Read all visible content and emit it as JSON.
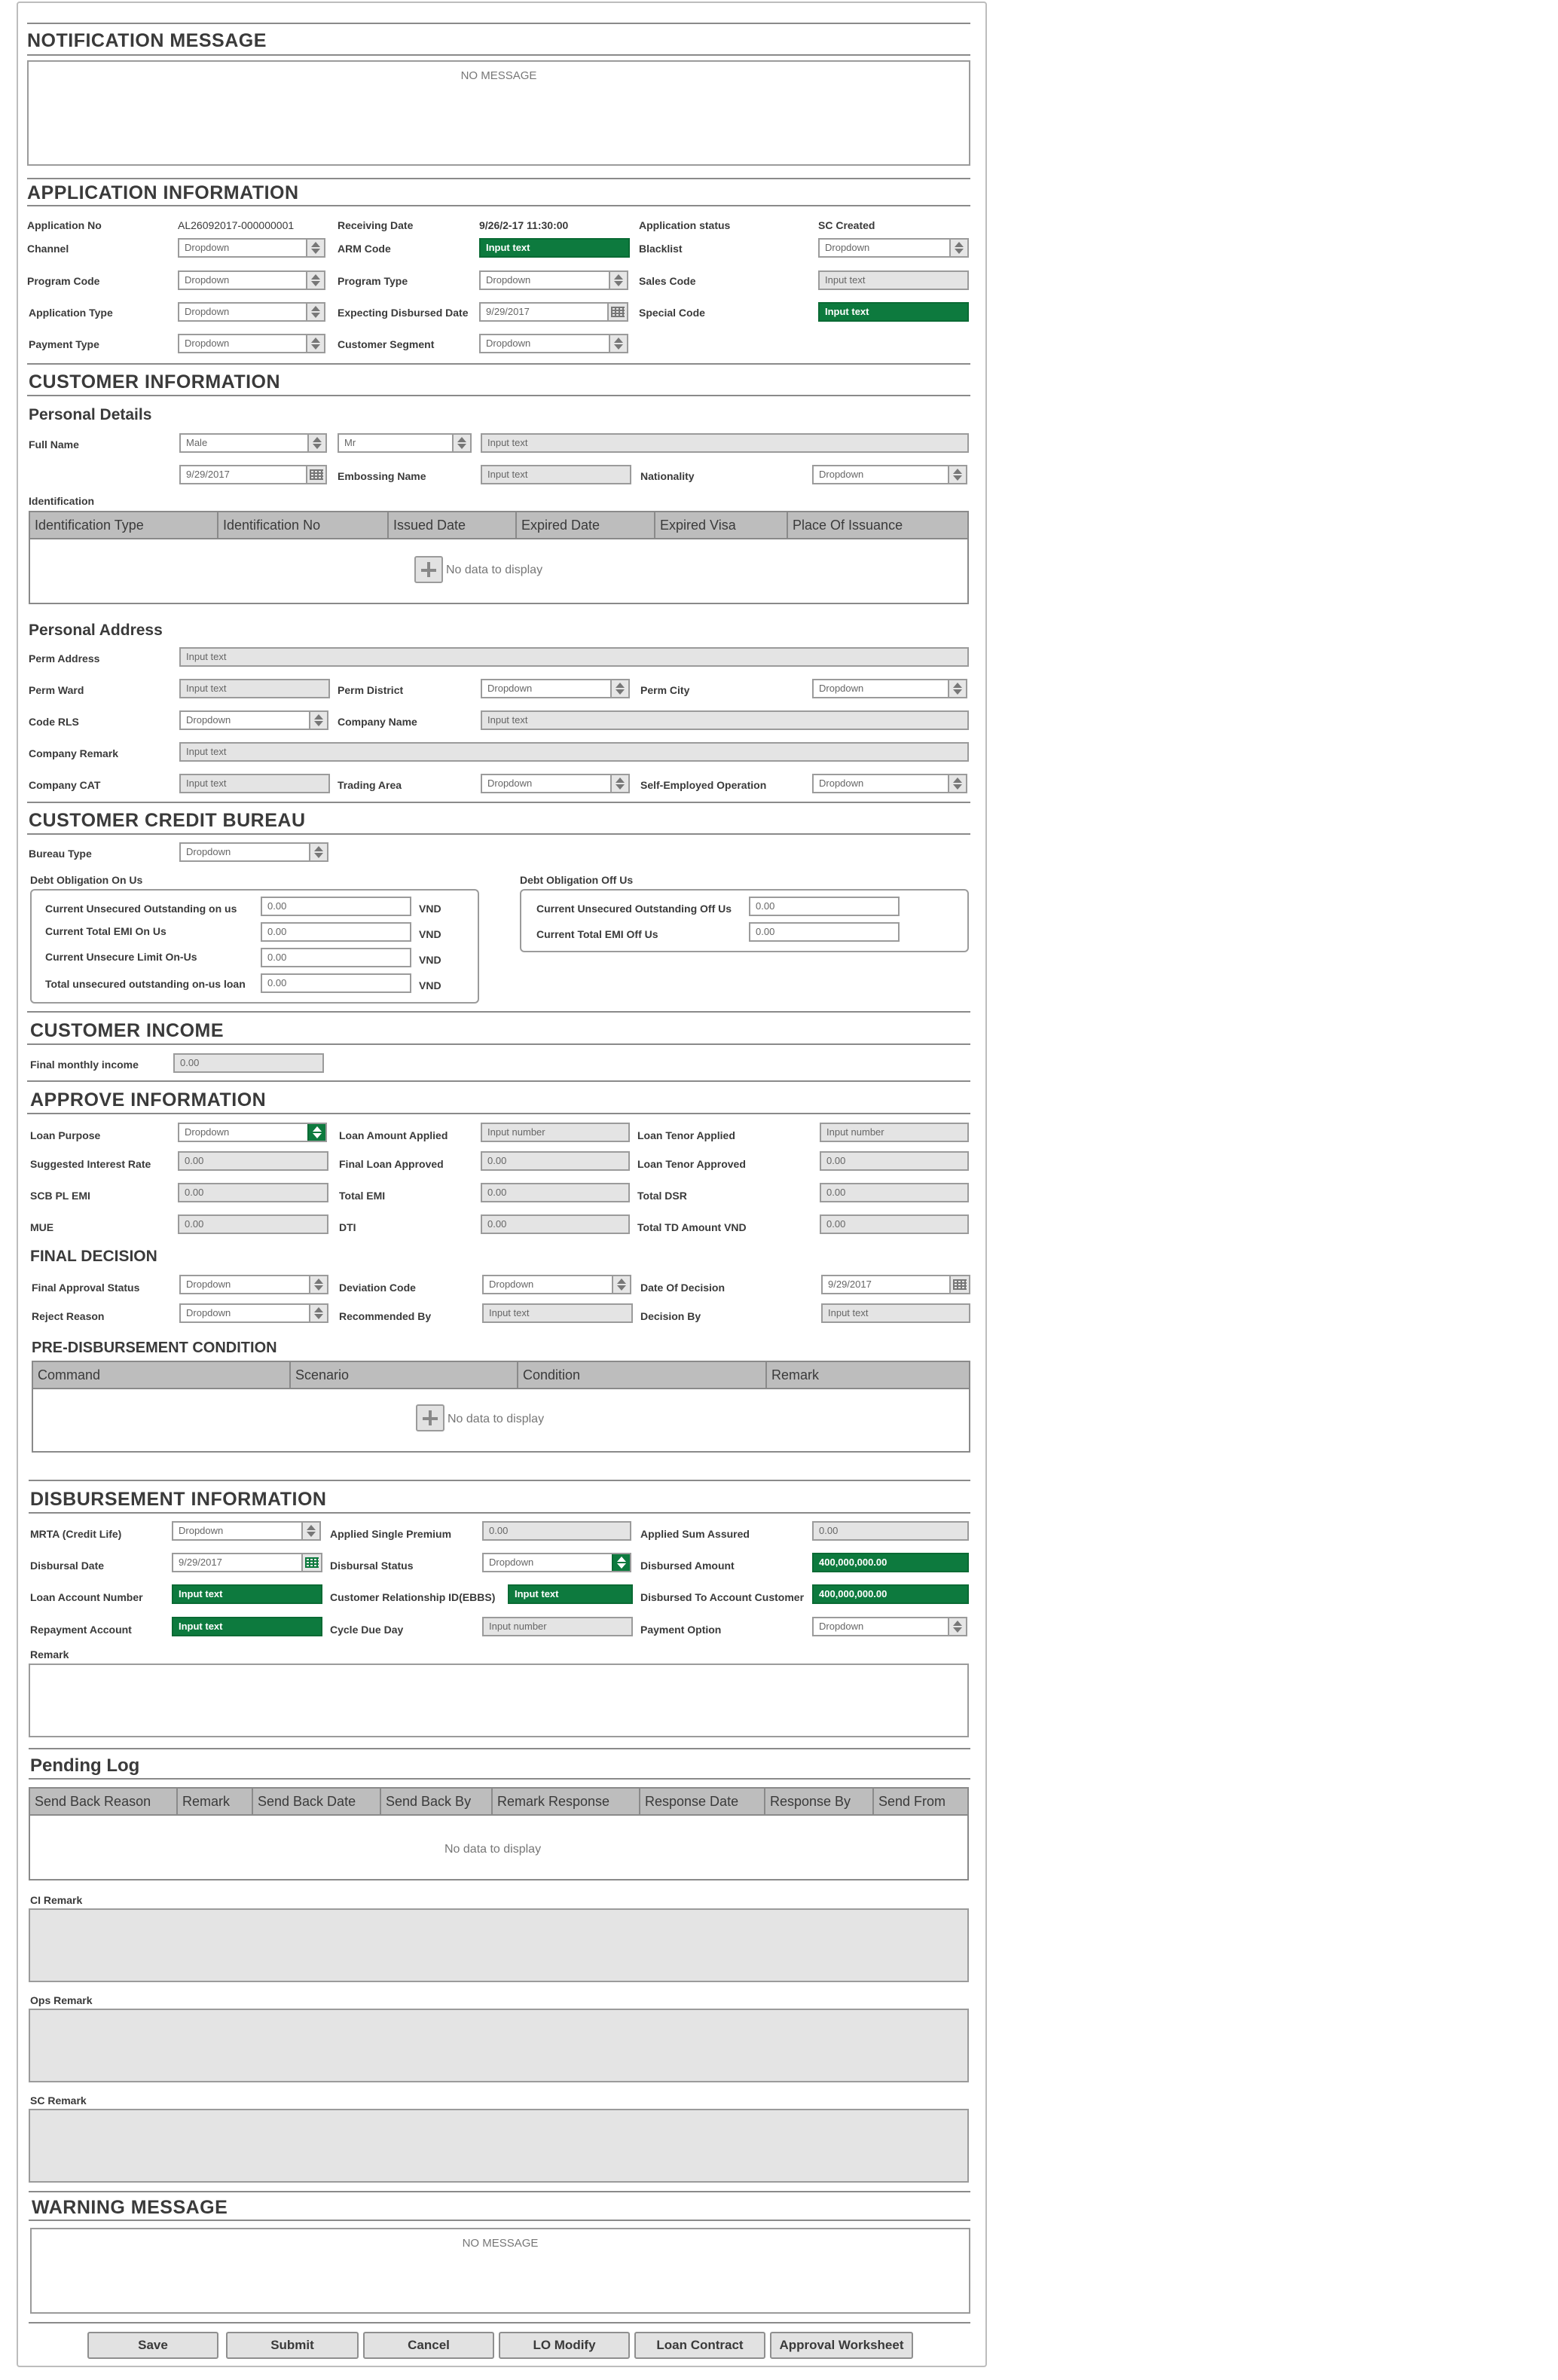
{
  "notification": {
    "title": "NOTIFICATION MESSAGE",
    "message": "NO MESSAGE"
  },
  "application": {
    "title": "APPLICATION INFORMATION",
    "application_no_label": "Application No",
    "application_no": "AL26092017-000000001",
    "receiving_date_label": "Receiving Date",
    "receiving_date": "9/26/2-17 11:30:00",
    "application_status_label": "Application status",
    "application_status": "SC Created",
    "channel_label": "Channel",
    "channel": "Dropdown",
    "arm_code_label": "ARM Code",
    "arm_code": "Input text",
    "blacklist_label": "Blacklist",
    "blacklist": "Dropdown",
    "program_code_label": "Program Code",
    "program_code": "Dropdown",
    "program_type_label": "Program Type",
    "program_type": "Dropdown",
    "sales_code_label": "Sales Code",
    "sales_code": "Input text",
    "application_type_label": "Application Type",
    "application_type": "Dropdown",
    "expecting_disbursed_date_label": "Expecting Disbursed Date",
    "expecting_disbursed_date": "9/29/2017",
    "special_code_label": "Special Code",
    "special_code": "Input text",
    "payment_type_label": "Payment Type",
    "payment_type": "Dropdown",
    "customer_segment_label": "Customer Segment",
    "customer_segment": "Dropdown"
  },
  "customer": {
    "title": "CUSTOMER INFORMATION",
    "personal_details_title": "Personal Details",
    "full_name_label": "Full Name",
    "gender": "Male",
    "salutation": "Mr",
    "full_name": "Input text",
    "dob": "9/29/2017",
    "embossing_name_label": "Embossing Name",
    "embossing_name": "Input text",
    "nationality_label": "Nationality",
    "nationality": "Dropdown",
    "identification_label": "Identification",
    "id_columns": [
      "Identification Type",
      "Identification No",
      "Issued Date",
      "Expired Date",
      "Expired Visa",
      "Place Of Issuance"
    ],
    "id_empty": "No data to display",
    "personal_address_title": "Personal Address",
    "perm_address_label": "Perm Address",
    "perm_address": "Input text",
    "perm_ward_label": "Perm Ward",
    "perm_ward": "Input text",
    "perm_district_label": "Perm District",
    "perm_district": "Dropdown",
    "perm_city_label": "Perm City",
    "perm_city": "Dropdown",
    "code_rls_label": "Code RLS",
    "code_rls": "Dropdown",
    "company_name_label": "Company Name",
    "company_name": "Input text",
    "company_remark_label": "Company Remark",
    "company_remark": "Input text",
    "company_cat_label": "Company CAT",
    "company_cat": "Input text",
    "trading_area_label": "Trading Area",
    "trading_area": "Dropdown",
    "self_employed_label": "Self-Employed Operation",
    "self_employed": "Dropdown"
  },
  "credit_bureau": {
    "title": "CUSTOMER CREDIT BUREAU",
    "bureau_type_label": "Bureau Type",
    "bureau_type": "Dropdown",
    "on_us_title": "Debt Obligation On Us",
    "off_us_title": "Debt Obligation Off Us",
    "on_us_rows": [
      {
        "label": "Current Unsecured Outstanding on us",
        "value": "0.00",
        "unit": "VND"
      },
      {
        "label": "Current Total EMI On Us",
        "value": "0.00",
        "unit": "VND"
      },
      {
        "label": "Current Unsecure Limit On-Us",
        "value": "0.00",
        "unit": "VND"
      },
      {
        "label": "Total unsecured outstanding on-us loan",
        "value": "0.00",
        "unit": "VND"
      }
    ],
    "off_us_rows": [
      {
        "label": "Current Unsecured Outstanding Off Us",
        "value": "0.00"
      },
      {
        "label": "Current Total EMI Off Us",
        "value": "0.00"
      }
    ]
  },
  "income": {
    "title": "CUSTOMER INCOME",
    "final_monthly_income_label": "Final monthly income",
    "final_monthly_income": "0.00"
  },
  "approve": {
    "title": "APPROVE INFORMATION",
    "loan_purpose_label": "Loan Purpose",
    "loan_purpose": "Dropdown",
    "loan_amount_applied_label": "Loan Amount Applied",
    "loan_amount_applied": "Input number",
    "loan_tenor_applied_label": "Loan Tenor Applied",
    "loan_tenor_applied": "Input number",
    "suggested_interest_rate_label": "Suggested Interest Rate",
    "suggested_interest_rate": "0.00",
    "final_loan_approved_label": "Final Loan Approved",
    "final_loan_approved": "0.00",
    "loan_tenor_approved_label": "Loan Tenor Approved",
    "loan_tenor_approved": "0.00",
    "scb_pl_emi_label": "SCB PL EMI",
    "scb_pl_emi": "0.00",
    "total_emi_label": "Total EMI",
    "total_emi": "0.00",
    "total_dsr_label": "Total DSR",
    "total_dsr": "0.00",
    "mue_label": "MUE",
    "mue": "0.00",
    "dti_label": "DTI",
    "dti": "0.00",
    "total_td_amount_label": "Total TD Amount VND",
    "total_td_amount": "0.00"
  },
  "final_decision": {
    "title": "FINAL DECISION",
    "final_approval_status_label": "Final Approval Status",
    "final_approval_status": "Dropdown",
    "deviation_code_label": "Deviation Code",
    "deviation_code": "Dropdown",
    "date_of_decision_label": "Date Of Decision",
    "date_of_decision": "9/29/2017",
    "reject_reason_label": "Reject Reason",
    "reject_reason": "Dropdown",
    "recommended_by_label": "Recommended By",
    "recommended_by": "Input text",
    "decision_by_label": "Decision By",
    "decision_by": "Input text"
  },
  "pre_disbursement": {
    "title": "PRE-DISBURSEMENT CONDITION",
    "columns": [
      "Command",
      "Scenario",
      "Condition",
      "Remark"
    ],
    "empty": "No data to display"
  },
  "disbursement": {
    "title": "DISBURSEMENT INFORMATION",
    "mrta_label": "MRTA (Credit Life)",
    "mrta": "Dropdown",
    "applied_single_premium_label": "Applied Single Premium",
    "applied_single_premium": "0.00",
    "applied_sum_assured_label": "Applied Sum Assured",
    "applied_sum_assured": "0.00",
    "disbursal_date_label": "Disbursal Date",
    "disbursal_date": "9/29/2017",
    "disbursal_status_label": "Disbursal Status",
    "disbursal_status": "Dropdown",
    "disbursed_amount_label": "Disbursed Amount",
    "disbursed_amount": "400,000,000.00",
    "loan_account_number_label": "Loan Account Number",
    "loan_account_number": "Input text",
    "customer_relationship_id_label": "Customer Relationship ID(EBBS)",
    "customer_relationship_id": "Input text",
    "disbursed_to_account_label": "Disbursed To Account Customer",
    "disbursed_to_account": "400,000,000.00",
    "repayment_account_label": "Repayment Account",
    "repayment_account": "Input text",
    "cycle_due_day_label": "Cycle Due Day",
    "cycle_due_day": "Input number",
    "payment_option_label": "Payment Option",
    "payment_option": "Dropdown",
    "remark_label": "Remark"
  },
  "pending_log": {
    "title": "Pending Log",
    "columns": [
      "Send Back Reason",
      "Remark",
      "Send Back Date",
      "Send Back By",
      "Remark Response",
      "Response Date",
      "Response By",
      "Send From"
    ],
    "empty": "No data to display",
    "ci_remark_label": "CI Remark",
    "ops_remark_label": "Ops Remark",
    "sc_remark_label": "SC Remark"
  },
  "warning": {
    "title": "WARNING MESSAGE",
    "message": "NO MESSAGE"
  },
  "buttons": {
    "save": "Save",
    "submit": "Submit",
    "cancel": "Cancel",
    "lo_modify": "LO Modify",
    "loan_contract": "Loan Contract",
    "approval_worksheet": "Approval Worksheet"
  },
  "colors": {
    "accent_green": "#0d7a3e",
    "header_gray": "#bdbdbd",
    "field_gray": "#e4e4e4"
  }
}
